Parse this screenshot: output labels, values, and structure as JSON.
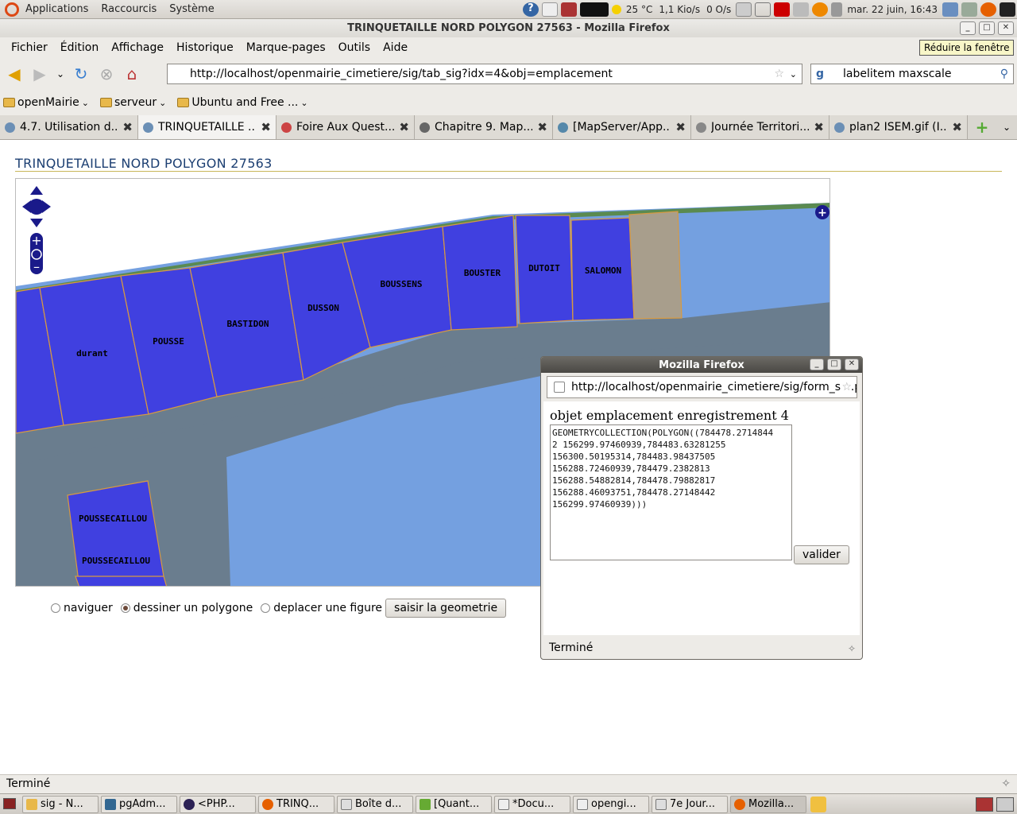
{
  "gnome_panel": {
    "menus": [
      "Applications",
      "Raccourcis",
      "Système"
    ],
    "weather": "25 °C",
    "net_down": "1,1 Kio/s",
    "net_up": "0 O/s",
    "clock": "mar. 22 juin, 16:43"
  },
  "window": {
    "title": "TRINQUETAILLE NORD POLYGON 27563 - Mozilla Firefox",
    "tooltip": "Réduire la fenêtre"
  },
  "menubar": [
    "Fichier",
    "Édition",
    "Affichage",
    "Historique",
    "Marque-pages",
    "Outils",
    "Aide"
  ],
  "nav": {
    "url": "http://localhost/openmairie_cimetiere/sig/tab_sig?idx=4&obj=emplacement",
    "search_value": "labelitem maxscale"
  },
  "bookmarks": [
    "openMairie",
    "serveur",
    "Ubuntu and Free ..."
  ],
  "tabs": [
    {
      "label": "4.7. Utilisation d..."
    },
    {
      "label": "TRINQUETAILLE ..."
    },
    {
      "label": "Foire Aux Quest..."
    },
    {
      "label": "Chapitre 9. Map..."
    },
    {
      "label": "[MapServer/App..."
    },
    {
      "label": "Journée Territori..."
    },
    {
      "label": "plan2 ISEM.gif (I..."
    }
  ],
  "page": {
    "title": "TRINQUETAILLE NORD POLYGON 27563",
    "map_labels": [
      "durant",
      "POUSSE",
      "BASTIDON",
      "DUSSON",
      "BOUSSENS",
      "BOUSTER",
      "DUTOIT",
      "SALOMON",
      "POUSSECAILLOU",
      "POUSSECAILLOU"
    ],
    "radio_naviguer": "naviguer",
    "radio_dessiner": "dessiner un polygone",
    "radio_deplacer": "deplacer une figure",
    "selected_mode": "dessiner un polygone",
    "saisir_button": "saisir la geometrie"
  },
  "popup": {
    "title": "Mozilla Firefox",
    "url": "http://localhost/openmairie_cimetiere/sig/form_sig.p",
    "heading": "objet emplacement enregistrement 4",
    "geometry": "GEOMETRYCOLLECTION(POLYGON((784478.2714844\n2 156299.97460939,784483.63281255\n156300.50195314,784483.98437505\n156288.72460939,784479.2382813\n156288.54882814,784478.79882817\n156288.46093751,784478.27148442\n156299.97460939)))",
    "valider": "valider",
    "status": "Terminé"
  },
  "statusbar": {
    "text": "Terminé"
  },
  "taskbar": [
    "sig - N...",
    "pgAdm...",
    "<PHP...",
    "TRINQ...",
    "Boîte d...",
    "[Quant...",
    "*Docu...",
    "opengi...",
    "7e Jour...",
    "Mozilla..."
  ],
  "colors": {
    "parcel": "#4040e0",
    "road": "#6a7d8e",
    "water": "#74a0e0",
    "selected": "#a89e8c",
    "title": "#1c3f72"
  }
}
